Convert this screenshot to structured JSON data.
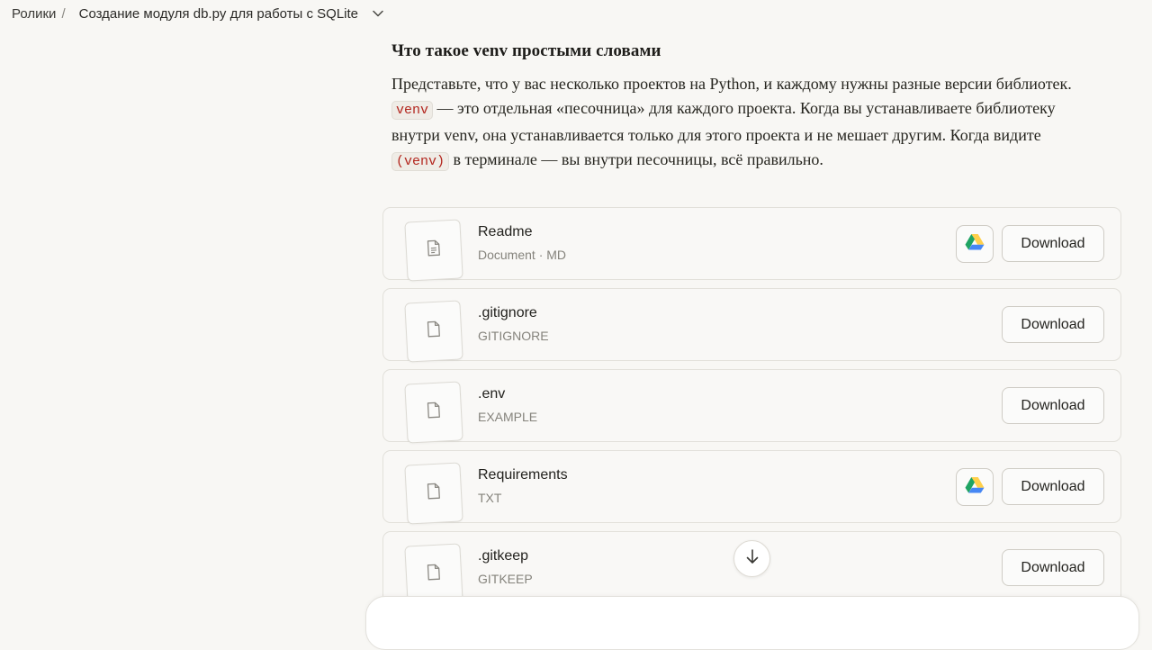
{
  "breadcrumb": {
    "root": "Ролики",
    "separator": "/",
    "title": "Создание модуля db.py для работы с SQLite"
  },
  "article": {
    "heading": "Что такое venv простыми словами",
    "p1": "Представьте, что у вас несколько проектов на Python, и каждому нужны разные версии библиотек. ",
    "code1": "venv",
    "p2": " — это отдельная «песочница» для каждого проекта. Когда вы устанавливаете библиотеку внутри venv, она устанавливается только для этого проекта и не мешает другим. Когда видите ",
    "code2": "(venv)",
    "p3": " в терминале — вы внутри песочницы, всё правильно."
  },
  "files": [
    {
      "name": "Readme",
      "meta": "Document · MD",
      "gdrive": true,
      "download": "Download",
      "icon": "text-document-icon"
    },
    {
      "name": ".gitignore",
      "meta": "GITIGNORE",
      "gdrive": false,
      "download": "Download",
      "icon": "file-icon"
    },
    {
      "name": ".env",
      "meta": "EXAMPLE",
      "gdrive": false,
      "download": "Download",
      "icon": "file-icon"
    },
    {
      "name": "Requirements",
      "meta": "TXT",
      "gdrive": true,
      "download": "Download",
      "icon": "file-icon"
    },
    {
      "name": ".gitkeep",
      "meta": "GITKEEP",
      "gdrive": false,
      "download": "Download",
      "icon": "file-icon"
    }
  ],
  "colors": {
    "background": "#f8f7f4",
    "code_text": "#b3261e",
    "gdrive_green": "#1fa463",
    "gdrive_yellow": "#ffd04b",
    "gdrive_blue": "#4687f4"
  }
}
